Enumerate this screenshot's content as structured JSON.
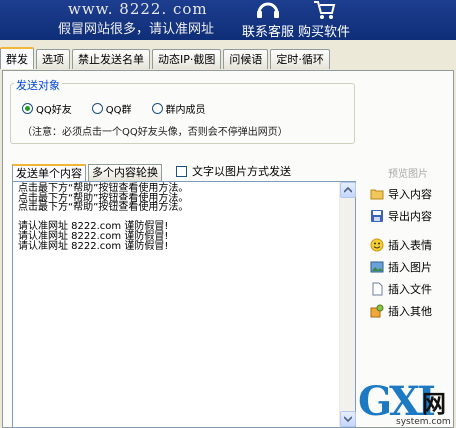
{
  "header": {
    "site": "www. 8222. com",
    "slogan": "假冒网站很多，请认准网址",
    "contact_label": "联系客服",
    "buy_label": "购买软件"
  },
  "tabs": [
    {
      "label": "群发"
    },
    {
      "label": "选项"
    },
    {
      "label": "禁止发送名单"
    },
    {
      "label": "动态IP·截图"
    },
    {
      "label": "问候语"
    },
    {
      "label": "定时·循环"
    }
  ],
  "target": {
    "group_title": "发送对象",
    "options": [
      "QQ好友",
      "QQ群",
      "群内成员"
    ],
    "selected": "QQ好友",
    "note": "（注意：必须点击一个QQ好友头像，否则会不停弹出网页）"
  },
  "content_tabs": [
    "发送单个内容",
    "多个内容轮换"
  ],
  "image_mode_label": "文字以图片方式发送",
  "editor_text": "点击最下方“帮助”按钮查看使用方法。\n点击最下方“帮助”按钮查看使用方法。\n点击最下方“帮助”按钮查看使用方法。\n\n请认准网址 8222.com 谨防假冒!\n请认准网址 8222.com 谨防假冒!\n请认准网址 8222.com 谨防假冒!",
  "side": {
    "preview": "预览图片",
    "import": "导入内容",
    "export": "导出内容",
    "emoji": "插入表情",
    "image": "插入图片",
    "file": "插入文件",
    "other": "插入其他"
  },
  "watermark": {
    "logo": "GXI",
    "wang": "网",
    "url": "system.com"
  }
}
